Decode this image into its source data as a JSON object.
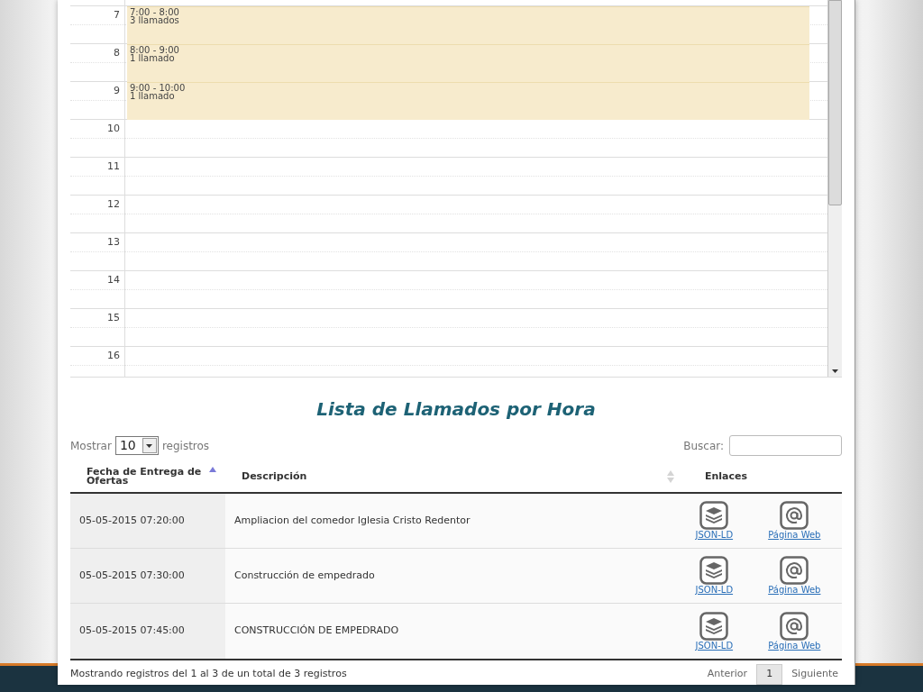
{
  "calendar": {
    "hours": [
      {
        "label": "7",
        "event": {
          "time": "7:00 - 8:00",
          "count": "3 llamados"
        }
      },
      {
        "label": "8",
        "event": {
          "time": "8:00 - 9:00",
          "count": "1 llamado"
        }
      },
      {
        "label": "9",
        "event": {
          "time": "9:00 - 10:00",
          "count": "1 llamado"
        }
      },
      {
        "label": "10"
      },
      {
        "label": "11"
      },
      {
        "label": "12"
      },
      {
        "label": "13"
      },
      {
        "label": "14"
      },
      {
        "label": "15"
      },
      {
        "label": "16"
      }
    ]
  },
  "title": "Lista de Llamados por Hora",
  "length_control": {
    "prefix": "Mostrar",
    "value": "10",
    "suffix": "registros"
  },
  "search": {
    "label": "Buscar:"
  },
  "table": {
    "columns": [
      {
        "label": "Fecha de Entrega de Ofertas",
        "sortable": true,
        "sorted_ascending": true
      },
      {
        "label": "Descripción",
        "sortable": true,
        "sorted_ascending": false
      },
      {
        "label": "Enlaces",
        "sortable": false
      }
    ],
    "rows": [
      {
        "date": "05-05-2015 07:20:00",
        "description": "Ampliacion del comedor Iglesia Cristo Redentor",
        "links": [
          {
            "kind": "json",
            "label": "JSON-LD"
          },
          {
            "kind": "web",
            "label": "Página Web"
          }
        ]
      },
      {
        "date": "05-05-2015 07:30:00",
        "description": "Construcción de empedrado",
        "links": [
          {
            "kind": "json",
            "label": "JSON-LD"
          },
          {
            "kind": "web",
            "label": "Página Web"
          }
        ]
      },
      {
        "date": "05-05-2015 07:45:00",
        "description": "CONSTRUCCIÓN DE EMPEDRADO",
        "links": [
          {
            "kind": "json",
            "label": "JSON-LD"
          },
          {
            "kind": "web",
            "label": "Página Web"
          }
        ]
      }
    ]
  },
  "info": "Mostrando registros del 1 al 3 de un total de 3 registros",
  "pagination": [
    {
      "label": "Anterior",
      "selected": false
    },
    {
      "label": "1",
      "selected": true
    },
    {
      "label": "Siguiente",
      "selected": false
    }
  ]
}
